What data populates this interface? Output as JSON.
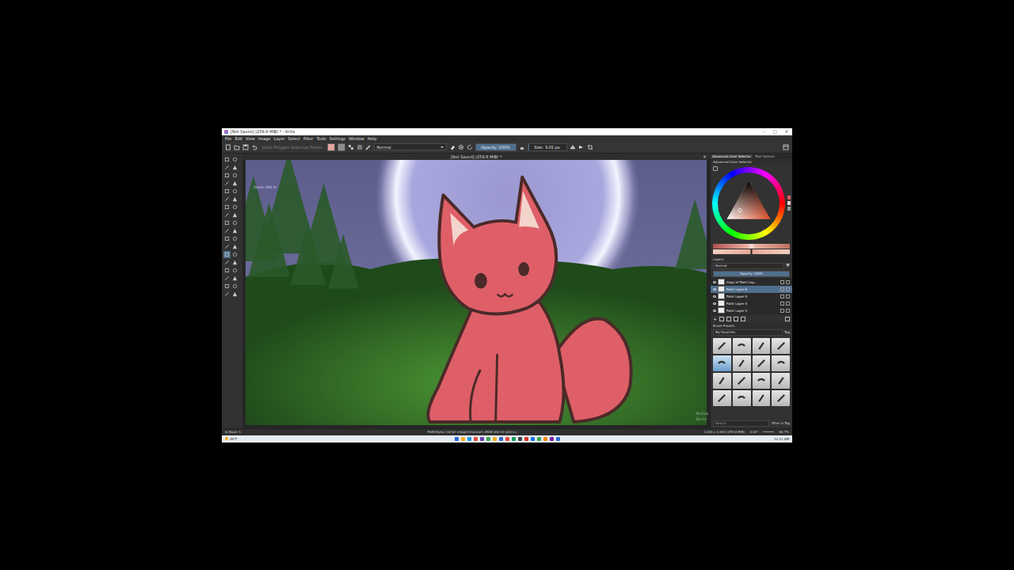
{
  "window": {
    "title": "[Not Saved] (259.8 MiB) * - Krita",
    "controls": [
      "–",
      "□",
      "✕"
    ]
  },
  "menu": [
    "File",
    "Edit",
    "View",
    "Image",
    "Layer",
    "Select",
    "Filter",
    "Tools",
    "Settings",
    "Window",
    "Help"
  ],
  "toolbar": {
    "undo_hint": "Undo Polygon Selection Points",
    "blend_mode": "Normal",
    "opacity": "Opacity: 100%",
    "opacity_level": 1,
    "size": "Size: 3.01 px",
    "size_level": 0.04
  },
  "tools": [
    {
      "selected": false
    },
    {
      "selected": false
    },
    {
      "selected": false
    },
    {
      "selected": false
    },
    {
      "selected": false
    },
    {
      "selected": false
    },
    {
      "selected": false
    },
    {
      "selected": false
    },
    {
      "selected": false
    },
    {
      "selected": false
    },
    {
      "selected": false
    },
    {
      "selected": false
    },
    {
      "selected": false
    },
    {
      "selected": false
    },
    {
      "selected": false
    },
    {
      "selected": false
    },
    {
      "selected": false
    },
    {
      "selected": false
    },
    {
      "selected": false
    },
    {
      "selected": false
    },
    {
      "selected": false
    },
    {
      "selected": false
    },
    {
      "selected": false
    },
    {
      "selected": false
    },
    {
      "selected": true
    },
    {
      "selected": false
    },
    {
      "selected": false
    },
    {
      "selected": false
    },
    {
      "selected": false
    },
    {
      "selected": false
    },
    {
      "selected": false
    },
    {
      "selected": false
    },
    {
      "selected": false
    },
    {
      "selected": false
    },
    {
      "selected": false
    },
    {
      "selected": false
    }
  ],
  "canvas": {
    "title": "[Not Saved] (259.8 MiB) *",
    "close": "×",
    "zoom_label": "Zoom 100 %"
  },
  "dockers": {
    "tabs": [
      {
        "label": "Advanced Color Selector",
        "selected": true
      },
      {
        "label": "Tool Options",
        "selected": false
      }
    ],
    "color_selector_title": "Advanced Color Selector",
    "layers": {
      "title": "Layers",
      "blend_mode": "Normal",
      "opacity": "Opacity: 100%",
      "opacity_level": 1,
      "items": [
        {
          "name": "Copy of Paint Lay...",
          "visible": true,
          "selected": false
        },
        {
          "name": "Paint Layer 6",
          "visible": true,
          "selected": true
        },
        {
          "name": "Paint Layer 5",
          "visible": true,
          "selected": false
        },
        {
          "name": "Paint Layer 4",
          "visible": true,
          "selected": false
        },
        {
          "name": "Paint Layer 3",
          "visible": true,
          "selected": false
        }
      ]
    },
    "brush_presets": {
      "title": "Brush Presets",
      "tag": "My Favorites",
      "tag_button": "Tag",
      "search_placeholder": "Search",
      "filter_label": "Filter in Tag",
      "brushes": [
        {
          "selected": false
        },
        {
          "selected": false
        },
        {
          "selected": false
        },
        {
          "selected": false
        },
        {
          "selected": true
        },
        {
          "selected": false
        },
        {
          "selected": false
        },
        {
          "selected": false
        },
        {
          "selected": false
        },
        {
          "selected": false
        },
        {
          "selected": false
        },
        {
          "selected": false
        },
        {
          "selected": false
        },
        {
          "selected": false
        },
        {
          "selected": false
        },
        {
          "selected": false
        }
      ]
    }
  },
  "status_bar": {
    "brush": "b) Basic-1",
    "color_space": "RGB/Alpha (16-bit integer/channel)  sRGB-elle-V2-g10.icc",
    "dimensions": "2,000 x 2,000 (259.8 MiB)",
    "rotation": "0.00°",
    "zoom": "66.7%"
  },
  "watermark": [
    "Activa",
    "Go to"
  ],
  "taskbar": {
    "weather": "49°F",
    "time": "12:21 AM"
  }
}
